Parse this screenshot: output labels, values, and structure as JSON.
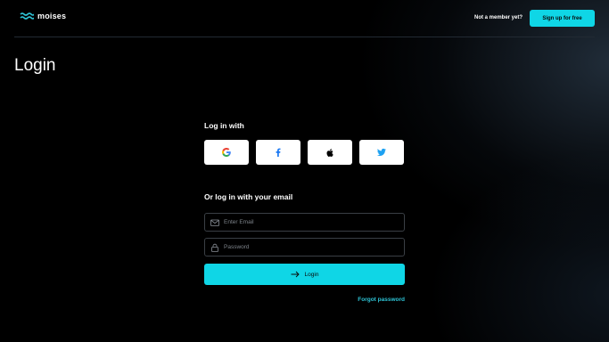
{
  "header": {
    "logo_text": "moises",
    "member_prompt": "Not a member yet?",
    "signup_label": "Sign up for free"
  },
  "page": {
    "title": "Login"
  },
  "social": {
    "heading": "Log in with",
    "providers": [
      "google-icon",
      "facebook-icon",
      "apple-icon",
      "twitter-icon"
    ]
  },
  "email_login": {
    "heading": "Or log in with your email",
    "email_placeholder": "Enter Email",
    "password_placeholder": "Password",
    "login_label": "Login",
    "forgot_label": "Forgot password"
  },
  "colors": {
    "accent": "#0fd6e6",
    "link": "#2ec4d6",
    "background": "#000000"
  }
}
